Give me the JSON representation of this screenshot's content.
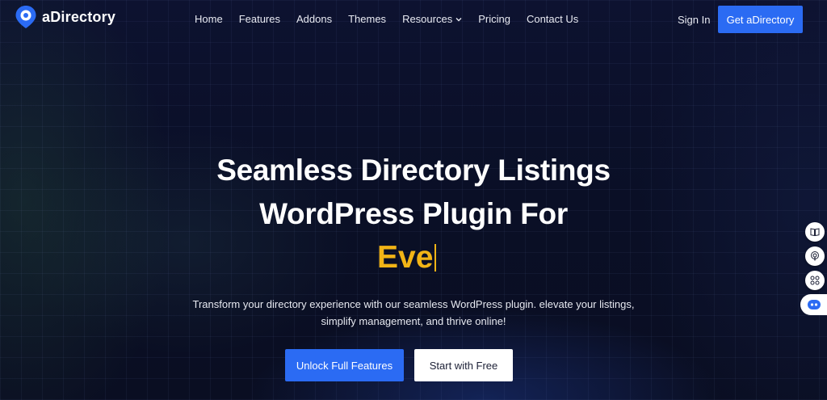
{
  "brand": {
    "name": "aDirectory",
    "accent": "#2b6bf3",
    "highlight": "#f2b416"
  },
  "nav": {
    "items": [
      {
        "label": "Home"
      },
      {
        "label": "Features"
      },
      {
        "label": "Addons"
      },
      {
        "label": "Themes"
      },
      {
        "label": "Resources",
        "has_dropdown": true
      },
      {
        "label": "Pricing"
      },
      {
        "label": "Contact Us"
      }
    ],
    "sign_in": "Sign In",
    "cta": "Get aDirectory"
  },
  "hero": {
    "title_line1": "Seamless Directory Listings",
    "title_line2": "WordPress Plugin For",
    "typed_text": "Eve",
    "subtitle_line1": "Transform your directory experience with our seamless WordPress plugin. elevate your listings,",
    "subtitle_line2": "simplify management, and thrive online!",
    "primary_button": "Unlock Full Features",
    "secondary_button": "Start with Free"
  },
  "side_widgets": [
    "book-icon",
    "podcast-icon",
    "grid-icon",
    "chat-bot-icon"
  ]
}
